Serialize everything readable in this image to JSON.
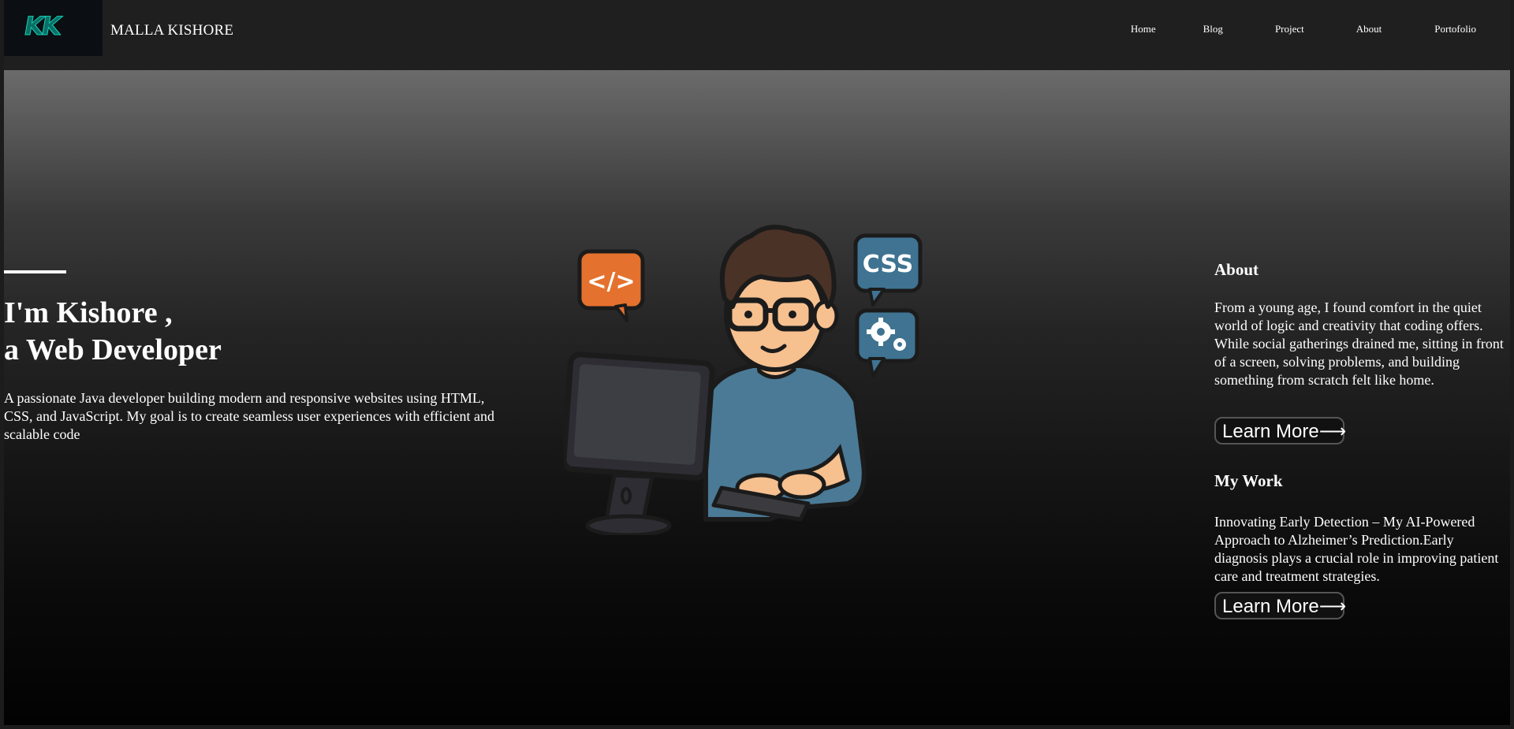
{
  "brand": {
    "logo_text": "KK",
    "name": "MALLA KISHORE"
  },
  "nav": {
    "links": [
      "Home",
      "Blog",
      "Project",
      "About",
      "Portofolio"
    ]
  },
  "hero": {
    "heading_line1": "I'm Kishore ,",
    "heading_line2": "a Web Developer",
    "description": "A passionate Java developer building modern and responsive websites using HTML, CSS, and JavaScript. My goal is to create seamless user experiences with efficient and scalable code",
    "illustration": {
      "code_bubble": "</>",
      "css_bubble": "CSS",
      "gear_bubble": "gear-icon"
    }
  },
  "about": {
    "title": "About",
    "text": "From a young age, I found comfort in the quiet world of logic and creativity that coding offers. While social gatherings drained me, sitting in front of a screen, solving problems, and building something from scratch felt like home.",
    "button": "Learn More⟶"
  },
  "work": {
    "title": "My Work",
    "text": "Innovating Early Detection – My AI-Powered Approach to Alzheimer’s Prediction.Early diagnosis plays a crucial role in improving patient care and treatment strategies.",
    "button": "Learn More⟶"
  },
  "colors": {
    "logo_teal": "#13d3b8",
    "code_bubble": "#e4712d",
    "css_bubble": "#3f7391",
    "shirt": "#4a7a96"
  }
}
